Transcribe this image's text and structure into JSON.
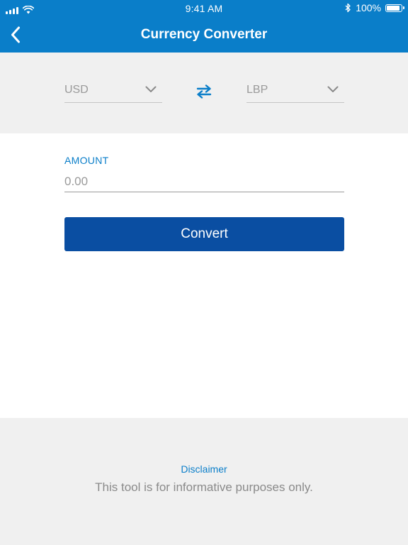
{
  "status_bar": {
    "time": "9:41 AM",
    "battery": "100%",
    "battery_level": 1.0,
    "signal_icon": "signal-bars-icon",
    "wifi_icon": "wifi-icon",
    "bluetooth_icon": "bluetooth-icon"
  },
  "nav": {
    "title": "Currency Converter",
    "back_icon": "chevron-left-icon"
  },
  "converter": {
    "from_currency": "USD",
    "to_currency": "LBP",
    "swap_icon": "swap-arrows-icon"
  },
  "amount": {
    "label": "AMOUNT",
    "placeholder": "0.00",
    "value": ""
  },
  "actions": {
    "convert_label": "Convert"
  },
  "footer": {
    "disclaimer_title": "Disclaimer",
    "disclaimer_text": "This tool is for informative purposes only."
  },
  "colors": {
    "primary": "#0a7ec9",
    "button": "#0a4ea2",
    "band_background": "#f0f0f0",
    "muted_text": "#9a9a9a"
  }
}
